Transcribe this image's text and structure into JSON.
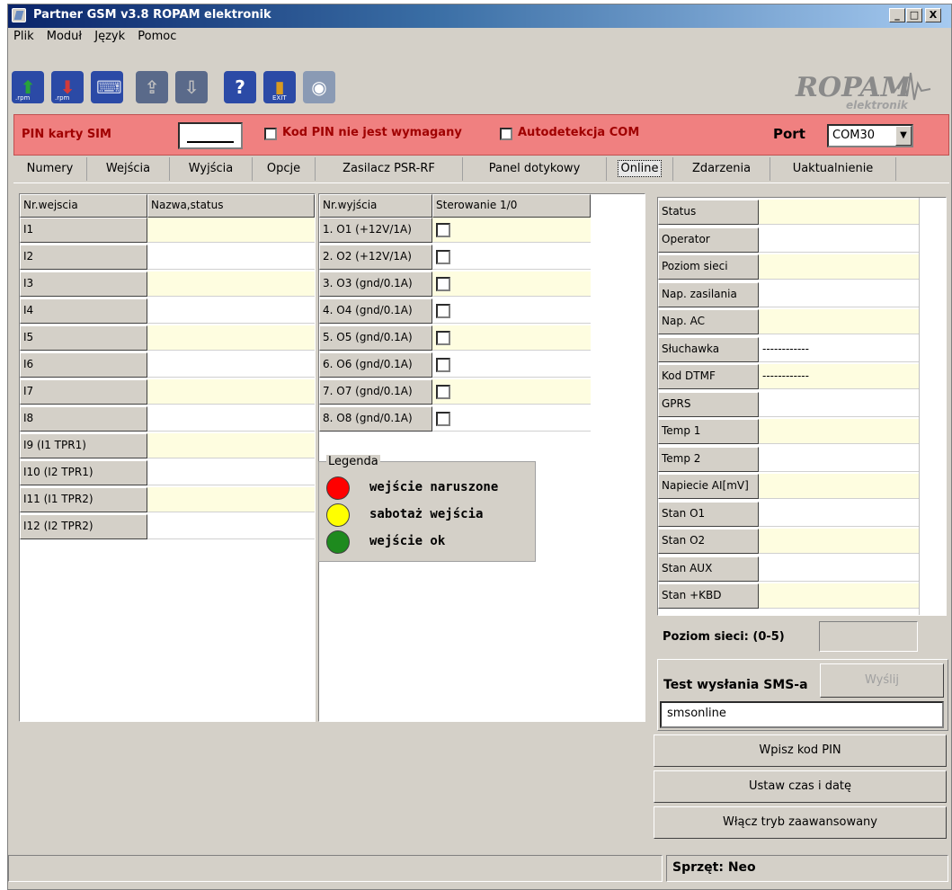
{
  "window": {
    "title": "Partner GSM v3.8 ROPAM elektronik",
    "minimize": "_",
    "maximize": "□",
    "close": "X"
  },
  "menu": [
    "Plik",
    "Moduł",
    "Język",
    "Pomoc"
  ],
  "toolbar": {
    "colors": {
      "green": "#27a33a",
      "red": "#d23a3a",
      "blue": "#2b4aa6",
      "gold": "#d89a20"
    },
    "icons": [
      "upload-rpm-icon",
      "download-rpm-icon",
      "keyboard-icon",
      "house-icon",
      "box-icon",
      "help-icon",
      "exit-icon",
      "signal-icon"
    ],
    "rpm_label": ".rpm",
    "help_glyph": "?",
    "exit_label": "EXIT"
  },
  "logo": {
    "text": "ROPAM",
    "sub": "elektronik"
  },
  "pinbar": {
    "label": "PIN karty SIM",
    "pin_not_required": "Kod PIN nie jest wymagany",
    "autodetect": "Autodetekcja COM",
    "port_label": "Port",
    "port_value": "COM30",
    "bg_color": "#f08080"
  },
  "tabs": [
    "Numery",
    "Wejścia",
    "Wyjścia",
    "Opcje",
    "Zasilacz PSR-RF",
    "Panel dotykowy",
    "Online",
    "Zdarzenia",
    "Uaktualnienie"
  ],
  "inputs": {
    "headers": [
      "Nr.wejscia",
      "Nazwa,status"
    ],
    "rows": [
      "I1",
      "I2",
      "I3",
      "I4",
      "I5",
      "I6",
      "I7",
      "I8",
      "I9 (I1 TPR1)",
      "I10 (I2 TPR1)",
      "I11  (I1 TPR2)",
      "I12 (I2 TPR2)"
    ]
  },
  "outputs": {
    "headers": [
      "Nr.wyjścia",
      "Sterowanie 1/0"
    ],
    "rows": [
      "1. O1 (+12V/1A)",
      "2. O2 (+12V/1A)",
      "3. O3 (gnd/0.1A)",
      "4. O4 (gnd/0.1A)",
      "5. O5 (gnd/0.1A)",
      "6. O6  (gnd/0.1A)",
      "7. O7 (gnd/0.1A)",
      "8. O8 (gnd/0.1A)"
    ]
  },
  "legend": {
    "title": "Legenda",
    "items": [
      {
        "label": "wejście naruszone",
        "color": "#ff0000"
      },
      {
        "label": "sabotaż wejścia",
        "color": "#ffff00"
      },
      {
        "label": "wejście ok",
        "color": "#1e8a1e"
      }
    ]
  },
  "status_table": {
    "rows": [
      {
        "label": "Status",
        "value": ""
      },
      {
        "label": "Operator",
        "value": ""
      },
      {
        "label": "Poziom sieci",
        "value": ""
      },
      {
        "label": "Nap. zasilania",
        "value": ""
      },
      {
        "label": "Nap. AC",
        "value": ""
      },
      {
        "label": "Słuchawka",
        "value": "------------"
      },
      {
        "label": "Kod DTMF",
        "value": "------------"
      },
      {
        "label": "GPRS",
        "value": ""
      },
      {
        "label": "Temp 1",
        "value": ""
      },
      {
        "label": "Temp 2",
        "value": ""
      },
      {
        "label": "Napiecie AI[mV]",
        "value": ""
      },
      {
        "label": "Stan O1",
        "value": ""
      },
      {
        "label": "Stan O2",
        "value": ""
      },
      {
        "label": "Stan AUX",
        "value": ""
      },
      {
        "label": "Stan +KBD",
        "value": ""
      }
    ]
  },
  "signal": {
    "label": "Poziom sieci: (0-5)",
    "value": ""
  },
  "sms": {
    "label": "Test wysłania SMS-a",
    "send": "Wyślij",
    "text": "smsonline"
  },
  "actions": {
    "pin": "Wpisz kod  PIN",
    "time": "Ustaw czas i datę",
    "advanced": "Włącz tryb zaawansowany"
  },
  "statusbar": {
    "left": "",
    "device": "Sprzęt: Neo"
  }
}
